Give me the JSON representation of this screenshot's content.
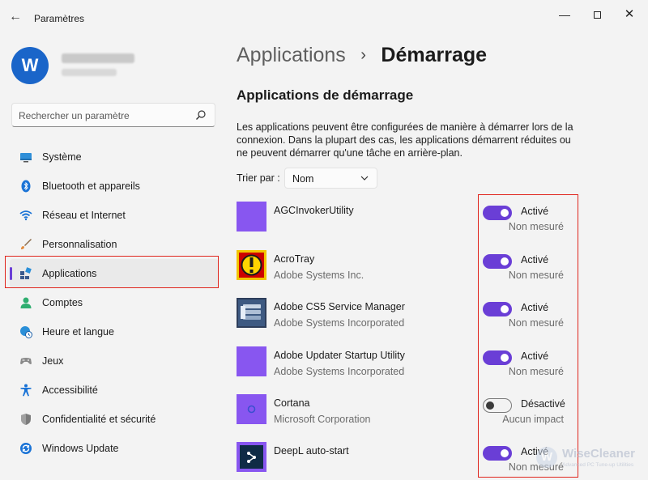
{
  "window": {
    "title": "Paramètres",
    "back_glyph": "←",
    "min_glyph": "—",
    "close_glyph": "✕"
  },
  "profile": {
    "avatar_letter": "W"
  },
  "search": {
    "placeholder": "Rechercher un paramètre"
  },
  "sidebar": {
    "items": [
      {
        "label": "Système",
        "icon": "system-icon"
      },
      {
        "label": "Bluetooth et appareils",
        "icon": "bluetooth-icon"
      },
      {
        "label": "Réseau et Internet",
        "icon": "wifi-icon"
      },
      {
        "label": "Personnalisation",
        "icon": "brush-icon"
      },
      {
        "label": "Applications",
        "icon": "apps-icon",
        "active": true
      },
      {
        "label": "Comptes",
        "icon": "account-icon"
      },
      {
        "label": "Heure et langue",
        "icon": "clock-globe-icon"
      },
      {
        "label": "Jeux",
        "icon": "gamepad-icon"
      },
      {
        "label": "Accessibilité",
        "icon": "accessibility-icon"
      },
      {
        "label": "Confidentialité et sécurité",
        "icon": "shield-icon"
      },
      {
        "label": "Windows Update",
        "icon": "update-icon"
      }
    ]
  },
  "breadcrumb": {
    "parent": "Applications",
    "separator": "›",
    "current": "Démarrage"
  },
  "main": {
    "section_title": "Applications de démarrage",
    "description": "Les applications peuvent être configurées de manière à démarrer lors de la connexion. Dans la plupart des cas, les applications démarrent réduites ou ne peuvent démarrer qu'une tâche en arrière-plan.",
    "sort_label": "Trier par :",
    "sort_value": "Nom"
  },
  "apps": [
    {
      "name": "AGCInvokerUtility",
      "publisher": "",
      "enabled": true,
      "state": "Activé",
      "impact": "Non mesuré",
      "icon": "purple-tile-icon"
    },
    {
      "name": "AcroTray",
      "publisher": "Adobe Systems Inc.",
      "enabled": true,
      "state": "Activé",
      "impact": "Non mesuré",
      "icon": "acrotray-icon"
    },
    {
      "name": "Adobe CS5 Service Manager",
      "publisher": "Adobe Systems Incorporated",
      "enabled": true,
      "state": "Activé",
      "impact": "Non mesuré",
      "icon": "cs5-service-manager-icon"
    },
    {
      "name": "Adobe Updater Startup Utility",
      "publisher": "Adobe Systems Incorporated",
      "enabled": true,
      "state": "Activé",
      "impact": "Non mesuré",
      "icon": "purple-tile-icon"
    },
    {
      "name": "Cortana",
      "publisher": "Microsoft Corporation",
      "enabled": false,
      "state": "Désactivé",
      "impact": "Aucun impact",
      "icon": "cortana-icon"
    },
    {
      "name": "DeepL auto-start",
      "publisher": "",
      "enabled": true,
      "state": "Activé",
      "impact": "Non mesuré",
      "icon": "deepl-icon"
    }
  ],
  "watermark": {
    "name": "WiseCleaner",
    "tagline": "Advanced PC Tune-up Utilities",
    "letter": "W"
  },
  "colors": {
    "accent": "#6a3ed6",
    "highlight_box": "#e0251d",
    "app_tile": "#8856f0"
  }
}
